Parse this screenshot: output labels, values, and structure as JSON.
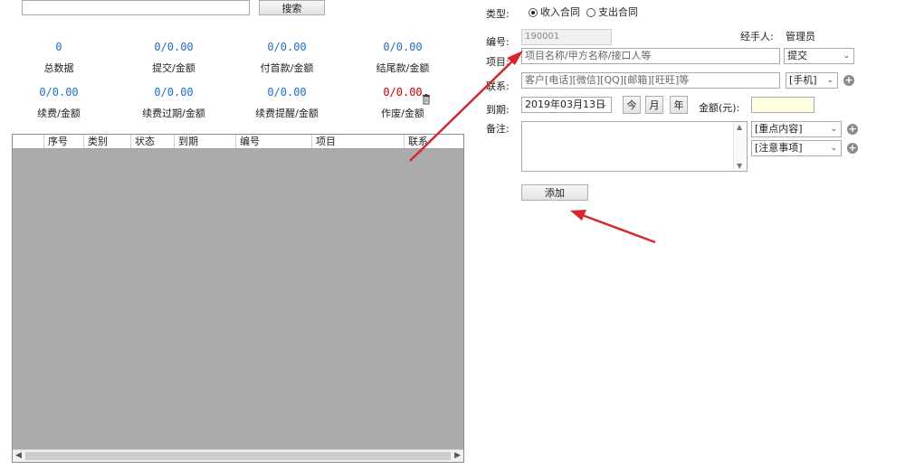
{
  "search": {
    "value": "",
    "button_label": "搜索"
  },
  "stats": [
    {
      "value": "0",
      "label": "总数据"
    },
    {
      "value": "0/0.00",
      "label": "提交/金额"
    },
    {
      "value": "0/0.00",
      "label": "付首款/金额"
    },
    {
      "value": "0/0.00",
      "label": "结尾款/金额"
    },
    {
      "value": "0/0.00",
      "label": "续费/金额"
    },
    {
      "value": "0/0.00",
      "label": "续费过期/金额"
    },
    {
      "value": "0/0.00",
      "label": "续费提醒/金额"
    },
    {
      "value": "0/0.00",
      "label": "作废/金额"
    }
  ],
  "colors": {
    "stat_blue": "#1e6fc1",
    "stat_red": "#c00000",
    "amount_bg": "#ffffe1",
    "grid_bg": "#ababab"
  },
  "table": {
    "columns": [
      "序号",
      "类别",
      "状态",
      "到期",
      "编号",
      "项目",
      "联系"
    ]
  },
  "form": {
    "type_label": "类型:",
    "type_options": [
      "收入合同",
      "支出合同"
    ],
    "type_selected": "收入合同",
    "id_label": "编号:",
    "id_value": "190001",
    "handler_label": "经手人:",
    "handler_value": "管理员",
    "project_label": "项目:",
    "project_placeholder": "项目名称/甲方名称/接口人等",
    "project_status": "提交",
    "contact_label": "联系:",
    "contact_placeholder": "客户[电话][微信][QQ][邮箱][旺旺]等",
    "contact_type": "[手机]",
    "due_label": "到期:",
    "due_date": "2019年03月13日",
    "btn_today": "今",
    "btn_month": "月",
    "btn_year": "年",
    "amount_label": "金额(元):",
    "amount_value": "",
    "note_label": "备注:",
    "note_value": "",
    "note_key": "[重点内容]",
    "note_attention": "[注意事项]",
    "add_button": "添加"
  },
  "icons": [
    "trash-icon",
    "plus-circle-icon",
    "chevron-down-icon",
    "calendar-dropdown-icon",
    "radio-icon"
  ]
}
